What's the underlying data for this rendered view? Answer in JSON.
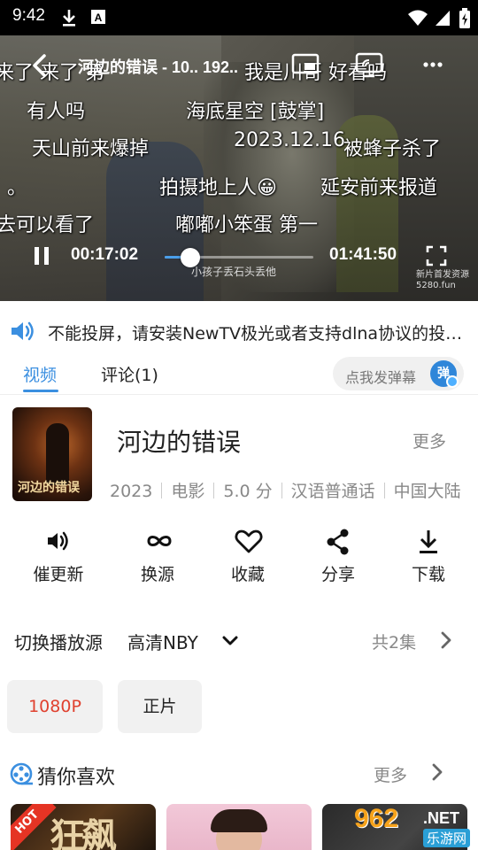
{
  "status_bar": {
    "time": "9:42",
    "icons": [
      "download-icon",
      "font-icon",
      "wifi-icon",
      "signal-icon",
      "battery-icon"
    ]
  },
  "player": {
    "title": "河边的错误 - 10.. 192..",
    "current_time": "00:17:02",
    "total_time": "01:41:50",
    "progress": 0.17,
    "subtitle": "小孩子丢石头丢他",
    "watermark_line1": "新片首发资源",
    "watermark_line2": "5280.fun",
    "danmaku": [
      "来了  来了  第",
      "我是川哥  好看吗",
      "有人吗",
      "海底星空  [鼓掌]",
      "天山前来爆掉",
      "2023.12.16",
      "被蜂子杀了",
      "。",
      "拍摄地上人😀",
      "延安前来报道",
      "去可以看了",
      "嘟嘟小笨蛋  第一"
    ]
  },
  "notice": {
    "text": "不能投屏，请安装NewTV极光或者支持dlna协议的投屏软件"
  },
  "tabs": [
    {
      "label": "视频",
      "active": true
    },
    {
      "label": "评论(1)",
      "active": false
    }
  ],
  "danmu_input": {
    "placeholder": "点我发弹幕",
    "badge": "弹"
  },
  "movie": {
    "poster_text": "河边的错误",
    "title": "河边的错误",
    "more": "更多",
    "meta": [
      "2023",
      "电影",
      "5.0 分",
      "汉语普通话",
      "中国大陆"
    ]
  },
  "actions": [
    {
      "label": "催更新",
      "icon": "speaker-icon"
    },
    {
      "label": "换源",
      "icon": "infinity-icon"
    },
    {
      "label": "收藏",
      "icon": "heart-icon"
    },
    {
      "label": "分享",
      "icon": "share-icon"
    },
    {
      "label": "下载",
      "icon": "download-icon"
    }
  ],
  "source": {
    "label": "切换播放源",
    "value": "高清NBY",
    "episodes": "共2集",
    "chips": [
      {
        "label": "1080P",
        "active": true
      },
      {
        "label": "正片",
        "active": false
      }
    ]
  },
  "recommend": {
    "title": "猜你喜欢",
    "more": "更多",
    "hot_tag": "HOT",
    "card1_text": "狂飙"
  },
  "site_badge": {
    "number": "962",
    "net": ".NET",
    "name": "乐游网"
  },
  "colors": {
    "accent": "#3b8fe0",
    "chip_active": "#e0412f",
    "hot": "#e53424"
  }
}
